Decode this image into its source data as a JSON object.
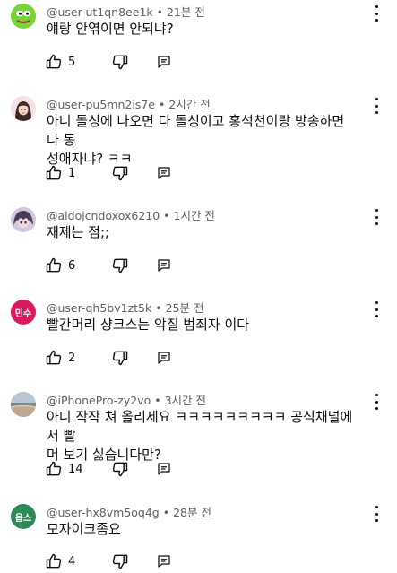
{
  "comments": [
    {
      "author": "@user-ut1qn8ee1k",
      "time": "21분 전",
      "text": "얘랑 안엮이면 안되냐?",
      "likes": "5",
      "avatar": {
        "kind": "pepe",
        "bg": "#7bd33a",
        "label": ""
      }
    },
    {
      "author": "@user-pu5mn2is7e",
      "time": "2시간 전",
      "text": "아니 돌싱에 나오면 다 돌싱이고 홍석천이랑 방송하면 다 동\n성애자냐? ㅋㅋ",
      "likes": "1",
      "avatar": {
        "kind": "photo-girl",
        "bg": "#f1e3e6",
        "label": ""
      }
    },
    {
      "author": "@aldojcndoxox6210",
      "time": "1시간 전",
      "text": "재제는 점;;",
      "likes": "6",
      "avatar": {
        "kind": "anime",
        "bg": "#cfc8df",
        "label": ""
      }
    },
    {
      "author": "@user-qh5bv1zt5k",
      "time": "25분 전",
      "text": "빨간머리 샹크스는 악질 범죄자 이다",
      "likes": "2",
      "avatar": {
        "kind": "initials",
        "bg": "#d81b60",
        "label": "민수"
      }
    },
    {
      "author": "@iPhonePro-zy2vo",
      "time": "3시간 전",
      "text": "아니 작작 쳐 올리세요 ㅋㅋㅋㅋㅋㅋㅋㅋㅋ 공식채널에서 빨\n머 보기 싫습니다만?",
      "likes": "14",
      "avatar": {
        "kind": "landscape",
        "bg": "#9fb2c2",
        "label": ""
      }
    },
    {
      "author": "@user-hx8vm5oq4g",
      "time": "28분 전",
      "text": "모자이크좀요",
      "likes": "4",
      "avatar": {
        "kind": "initials",
        "bg": "#2e8b57",
        "label": "옵스"
      }
    }
  ],
  "meta_separator": " • ",
  "icons": {
    "like": "thumb-up-icon",
    "dislike": "thumb-down-icon",
    "reply": "reply-icon",
    "menu": "more-vert-icon"
  }
}
